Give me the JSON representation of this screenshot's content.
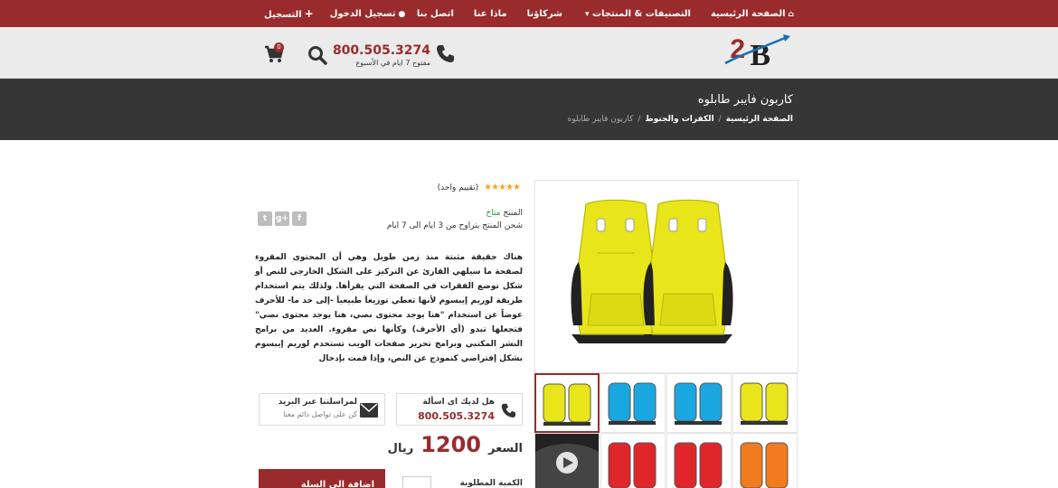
{
  "topbar": {
    "nav": [
      {
        "label": "الصفحة الرئيسية",
        "icon": "home-icon"
      },
      {
        "label": "التصنيفات & المنتجات",
        "icon": "caret-down-icon"
      },
      {
        "label": "شركاؤنا"
      },
      {
        "label": "ماذا عنا"
      },
      {
        "label": "اتصل بنا"
      }
    ],
    "login_label": "تسجيل الدخول",
    "register_label": "التسجيل"
  },
  "header": {
    "logo_text": "A2B",
    "phone": "800.505.3274",
    "phone_sub": "مفتوح 7 ايام في الأسبوع",
    "cart_count": "0"
  },
  "page": {
    "title": "كاربون فايبر طابلوه",
    "breadcrumb": [
      "الصفحة الرئيسية",
      "الكفرات والجنوط",
      "كاربون فايبر طابلوه"
    ]
  },
  "product": {
    "stars": 5,
    "rating_text": "(تقييم واحد)",
    "availability_label": "المنتج",
    "availability_value": "متاح",
    "shipping": "شحن المنتج يتراوح من 3 ايام الى 7 ايام",
    "description": "هناك حقيقة مثبتة منذ زمن طويل وهي أن المحتوى المقروء لصفحة ما سيلهي القارئ عن التركيز على الشكل الخارجي للنص أو شكل توضع الفقرات في الصفحة التي يقرأها. ولذلك يتم استخدام طريقة لوريم إيبسوم لأنها تعطي توزيعاَ طبيعياَ -إلى حد ما- للأحرف عوضاً عن استخدام \"هنا يوجد محتوى نصي، هنا يوجد محتوى نصي\" فتجعلها تبدو (أي الأحرف) وكأنها نص مقروء. العديد من برامح النشر المكتبي وبرامج تحرير صفحات الويب تستخدم لوريم إيبسوم بشكل إفتراضي كنموذج عن النص، وإذا قمت بإدخال",
    "contact_phone_title": "هل لديك اى اسألة",
    "contact_phone": "800.505.3274",
    "contact_email_title": "لمراسلتنا عبر البريد",
    "contact_email_sub": "كن على تواصل دائم معنا",
    "price_label": "السعر",
    "price": "1200",
    "currency": "ريال",
    "qty_label": "الكمية المطلوبة",
    "add_to_cart": "اضافة الى السلة"
  },
  "gallery": {
    "thumbs": [
      "yellow",
      "blue",
      "blue",
      "yellow",
      "video",
      "red",
      "red",
      "orange"
    ],
    "colors": {
      "yellow": "#e8e61a",
      "blue": "#1aa7e0",
      "red": "#e0262b",
      "orange": "#f07c1f"
    }
  },
  "colors": {
    "brand": "#9a2b2c",
    "dark": "#363636"
  }
}
